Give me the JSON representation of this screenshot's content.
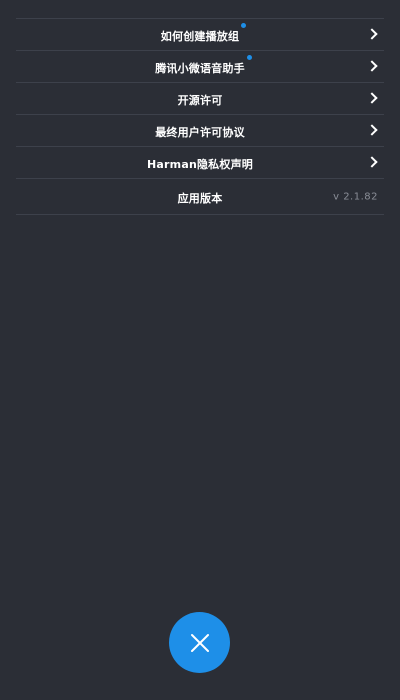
{
  "menu": {
    "items": [
      {
        "label": "如何创建播放组",
        "has_dot": true
      },
      {
        "label": "腾讯小微语音助手",
        "has_dot": true
      },
      {
        "label": "开源许可",
        "has_dot": false
      },
      {
        "label": "最终用户许可协议",
        "has_dot": false
      },
      {
        "label": "Harman隐私权声明",
        "has_dot": false
      }
    ],
    "version": {
      "label": "应用版本",
      "value": "v 2.1.82"
    }
  },
  "close_button": {
    "icon": "close-icon"
  },
  "colors": {
    "background": "#2b2e36",
    "accent": "#1e8fe8",
    "divider": "#3d414b",
    "muted_text": "#8a8e97"
  }
}
